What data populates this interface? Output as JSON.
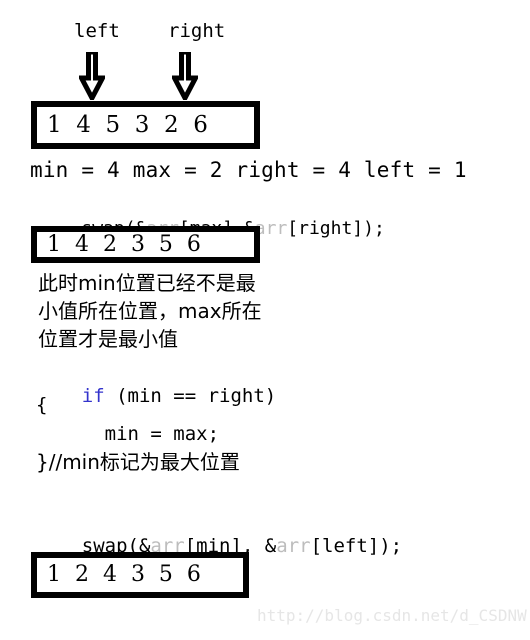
{
  "pointers": {
    "left_label": "left",
    "right_label": "right",
    "left_arrow_icon": "arrow-down-icon",
    "right_arrow_icon": "arrow-down-icon"
  },
  "arrays": {
    "before_swap": "1  4  5  3  2  6",
    "after_max_swap": "1  4  2  3  5  6",
    "after_min_swap": "1  2  4  3  5  6"
  },
  "state_line": "min = 4 max = 2 right = 4 left = 1",
  "code": {
    "swap_max": {
      "prefix": "swap(&",
      "dim_1": "arr",
      "middle": "[max],&",
      "dim_2": "arr",
      "suffix": "[right]);"
    },
    "if_keyword": "if",
    "if_condition": " (min == right)",
    "open_brace": "{",
    "assignment": "      min = max;",
    "close_brace_comment": "}//min标记为最大位置",
    "swap_min": {
      "prefix": "swap(&",
      "dim_1": "arr",
      "middle": "[min], &",
      "dim_2": "arr",
      "suffix": "[left]);"
    }
  },
  "note_cn": {
    "line_1": "此时min位置已经不是最",
    "line_2": "小值所在位置，max所在",
    "line_3": "位置才是最小值"
  },
  "watermark": "http://blog.csdn.net/d_CSDNW",
  "colors": {
    "background": "#ffffff",
    "foreground": "#000000",
    "keyword_blue": "#3333cc",
    "dim_gray": "#bdbdbd",
    "watermark_gray": "#e6e6e6",
    "box_border": "#000000"
  }
}
